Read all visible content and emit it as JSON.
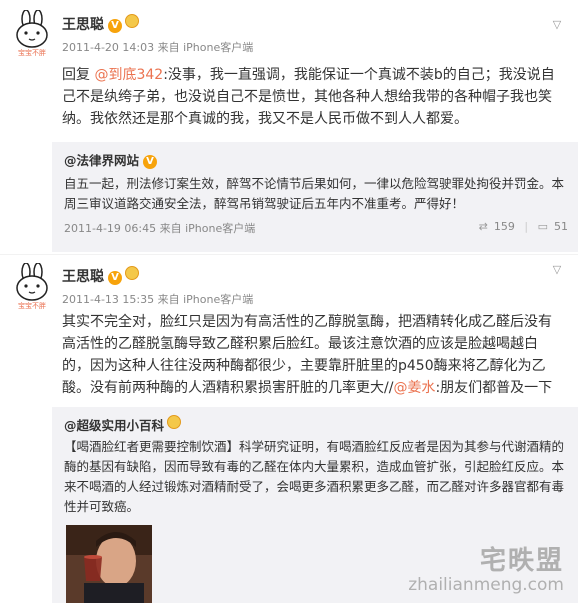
{
  "posts": [
    {
      "author": "王思聪",
      "avatar_caption": "宝宝不胖",
      "meta": "2011-4-20 14:03 来自 iPhone客户端",
      "text_parts": {
        "p1": "回复 ",
        "mention": "@到底342",
        "p2": ":没事，我一直强调，我能保证一个真诚不装b的自己；我没说自己不是纨绔子弟，也没说自己不是愤世，其他各种人想给我带的各种帽子我也笑纳。我依然还是那个真诚的我，我又不是人民币做不到人人都爱。"
      },
      "repost": {
        "author": "@法律界网站",
        "text": "自五一起，刑法修订案生效，醉驾不论情节后果如何，一律以危险驾驶罪处拘役并罚金。本周三审议道路交通安全法，醉驾吊销驾驶证后五年内不准重考。严得好！",
        "meta": "2011-4-19 06:45 来自 iPhone客户端",
        "reposts": "159",
        "comments": "51"
      }
    },
    {
      "author": "王思聪",
      "avatar_caption": "宝宝不胖",
      "meta": "2011-4-13 15:35 来自 iPhone客户端",
      "text_parts": {
        "p1": "其实不完全对，脸红只是因为有高活性的乙醇脱氢酶，把酒精转化成乙醛后没有高活性的乙醛脱氢酶导致乙醛积累后脸红。最该注意饮酒的应该是脸越喝越白的，因为这种人往往没两种酶都很少，主要靠肝脏里的p450酶来将乙醇化为乙酸。没有前两种酶的人酒精积累损害肝脏的几率更大//",
        "mention": "@姜水",
        "p2": ":朋友们都普及一下"
      },
      "repost": {
        "author": "@超级实用小百科",
        "text": "【喝酒脸红者更需要控制饮酒】科学研究证明，有喝酒脸红反应者是因为其参与代谢酒精的酶的基因有缺陷，因而导致有毒的乙醛在体内大量累积，造成血管扩张，引起脸红反应。本来不喝酒的人经过锻炼对酒精耐受了，会喝更多酒积累更多乙醛，而乙醛对许多器官都有毒性并可致癌。"
      }
    }
  ],
  "watermark": {
    "cn": "宅昳盟",
    "en": "zhailianmeng.com"
  },
  "icons": {
    "verified": "verified-v-badge-icon",
    "medal": "medal-icon",
    "more": "chevron-down-icon",
    "repost": "repost-icon",
    "comment": "comment-icon"
  },
  "colors": {
    "link": "#eb7350",
    "verified": "#f7a30b",
    "repost_bg": "#f2f2f5",
    "meta": "#888888"
  }
}
